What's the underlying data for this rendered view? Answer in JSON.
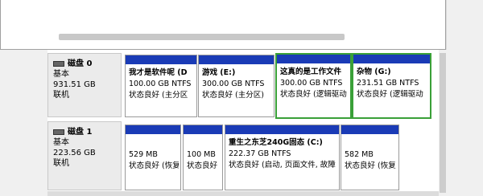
{
  "disks": [
    {
      "name": "磁盘 0",
      "type": "基本",
      "size": "931.51 GB",
      "status": "联机",
      "partitions": [
        {
          "title": "我才是软件呢 (D",
          "size": "100.00 GB NTFS",
          "status": "状态良好 (主分区"
        },
        {
          "title": "游戏 (E:)",
          "size": "300.00 GB NTFS",
          "status": "状态良好 (主分区)"
        },
        {
          "title": "这真的是工作文件",
          "size": "300.00 GB NTFS",
          "status": "状态良好 (逻辑驱动"
        },
        {
          "title": "杂物 (G:)",
          "size": "231.51 GB NTFS",
          "status": "状态良好 (逻辑驱动"
        }
      ]
    },
    {
      "name": "磁盘 1",
      "type": "基本",
      "size": "223.56 GB",
      "status": "联机",
      "partitions": [
        {
          "title": "",
          "size": "529 MB",
          "status": "状态良好 (恢复"
        },
        {
          "title": "",
          "size": "100 MB",
          "status": "状态良好"
        },
        {
          "title": "重生之东芝240G固态 (C:)",
          "size": "222.37 GB NTFS",
          "status": "状态良好 (启动, 页面文件, 故障"
        },
        {
          "title": "",
          "size": "582 MB",
          "status": "状态良好 (恢复"
        }
      ]
    }
  ],
  "colors": {
    "primary_partition": "#1a3bb6",
    "selection": "#3aa038"
  }
}
